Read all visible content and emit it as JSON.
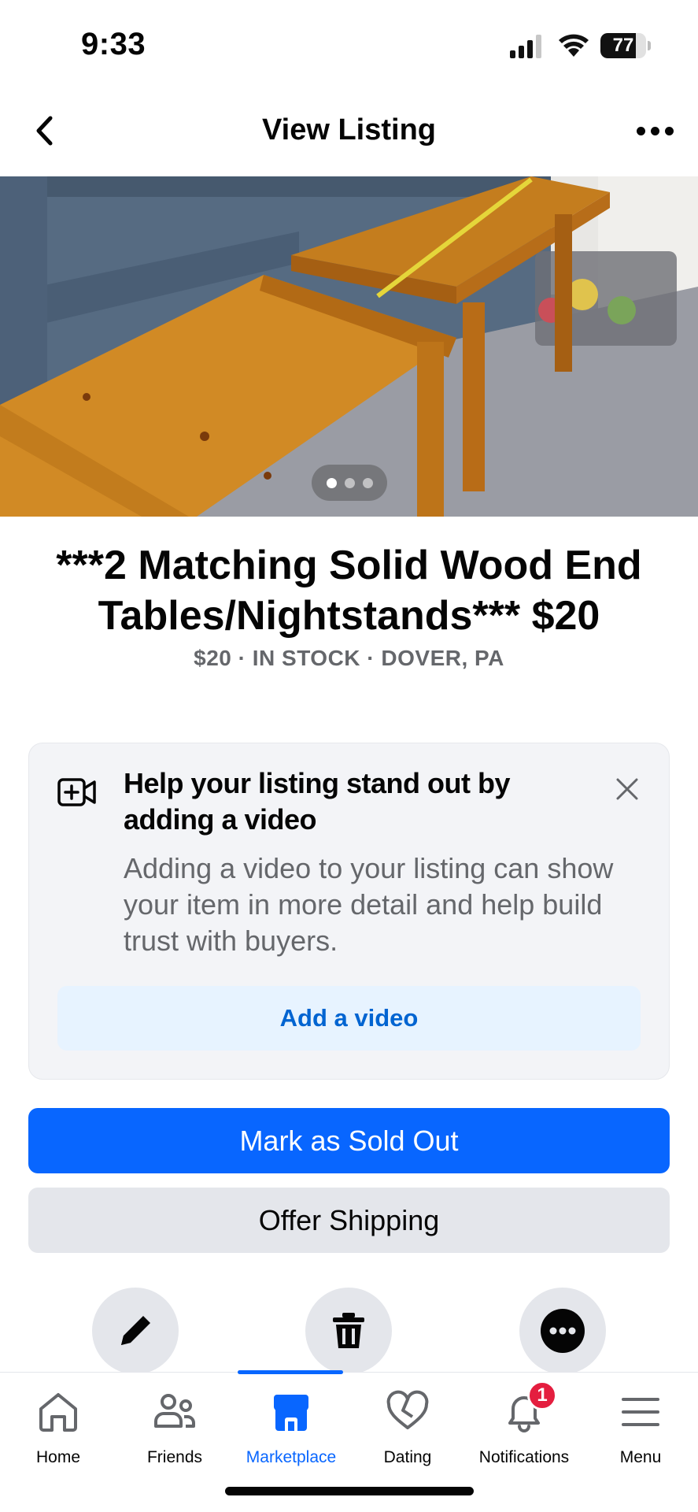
{
  "status_bar": {
    "time": "9:33",
    "battery_level": "77",
    "battery_fraction": 0.77
  },
  "header": {
    "title": "View Listing",
    "back_icon": "chevron-left-icon",
    "more_icon": "more-horizontal-icon"
  },
  "photo": {
    "description_icon": "listing-photo",
    "page_count": 3,
    "current_page": 1
  },
  "listing": {
    "title": "***2 Matching Solid Wood End Tables/Nightstands*** $20",
    "meta": "$20 · IN STOCK · DOVER, PA"
  },
  "video_card": {
    "icon": "video-add-icon",
    "heading": "Help your listing stand out by adding a video",
    "body": "Adding a video to your listing can show your item in more detail and help build trust with buyers.",
    "button_label": "Add a video",
    "close_icon": "close-icon"
  },
  "actions": {
    "mark_sold_label": "Mark as Sold Out",
    "offer_shipping_label": "Offer Shipping",
    "edit_icon": "pencil-icon",
    "delete_icon": "trash-icon",
    "more_icon": "more-horizontal-icon"
  },
  "tab_bar": {
    "tabs": [
      {
        "label": "Home",
        "icon": "home-icon"
      },
      {
        "label": "Friends",
        "icon": "friends-icon"
      },
      {
        "label": "Marketplace",
        "icon": "marketplace-icon",
        "active": true
      },
      {
        "label": "Dating",
        "icon": "heart-icon"
      },
      {
        "label": "Notifications",
        "icon": "bell-icon",
        "badge": "1"
      },
      {
        "label": "Menu",
        "icon": "menu-icon"
      }
    ]
  },
  "colors": {
    "accent": "#0866ff",
    "secondary_text": "#65676b",
    "badge": "#e41e3f",
    "link_text": "#0064d1"
  }
}
